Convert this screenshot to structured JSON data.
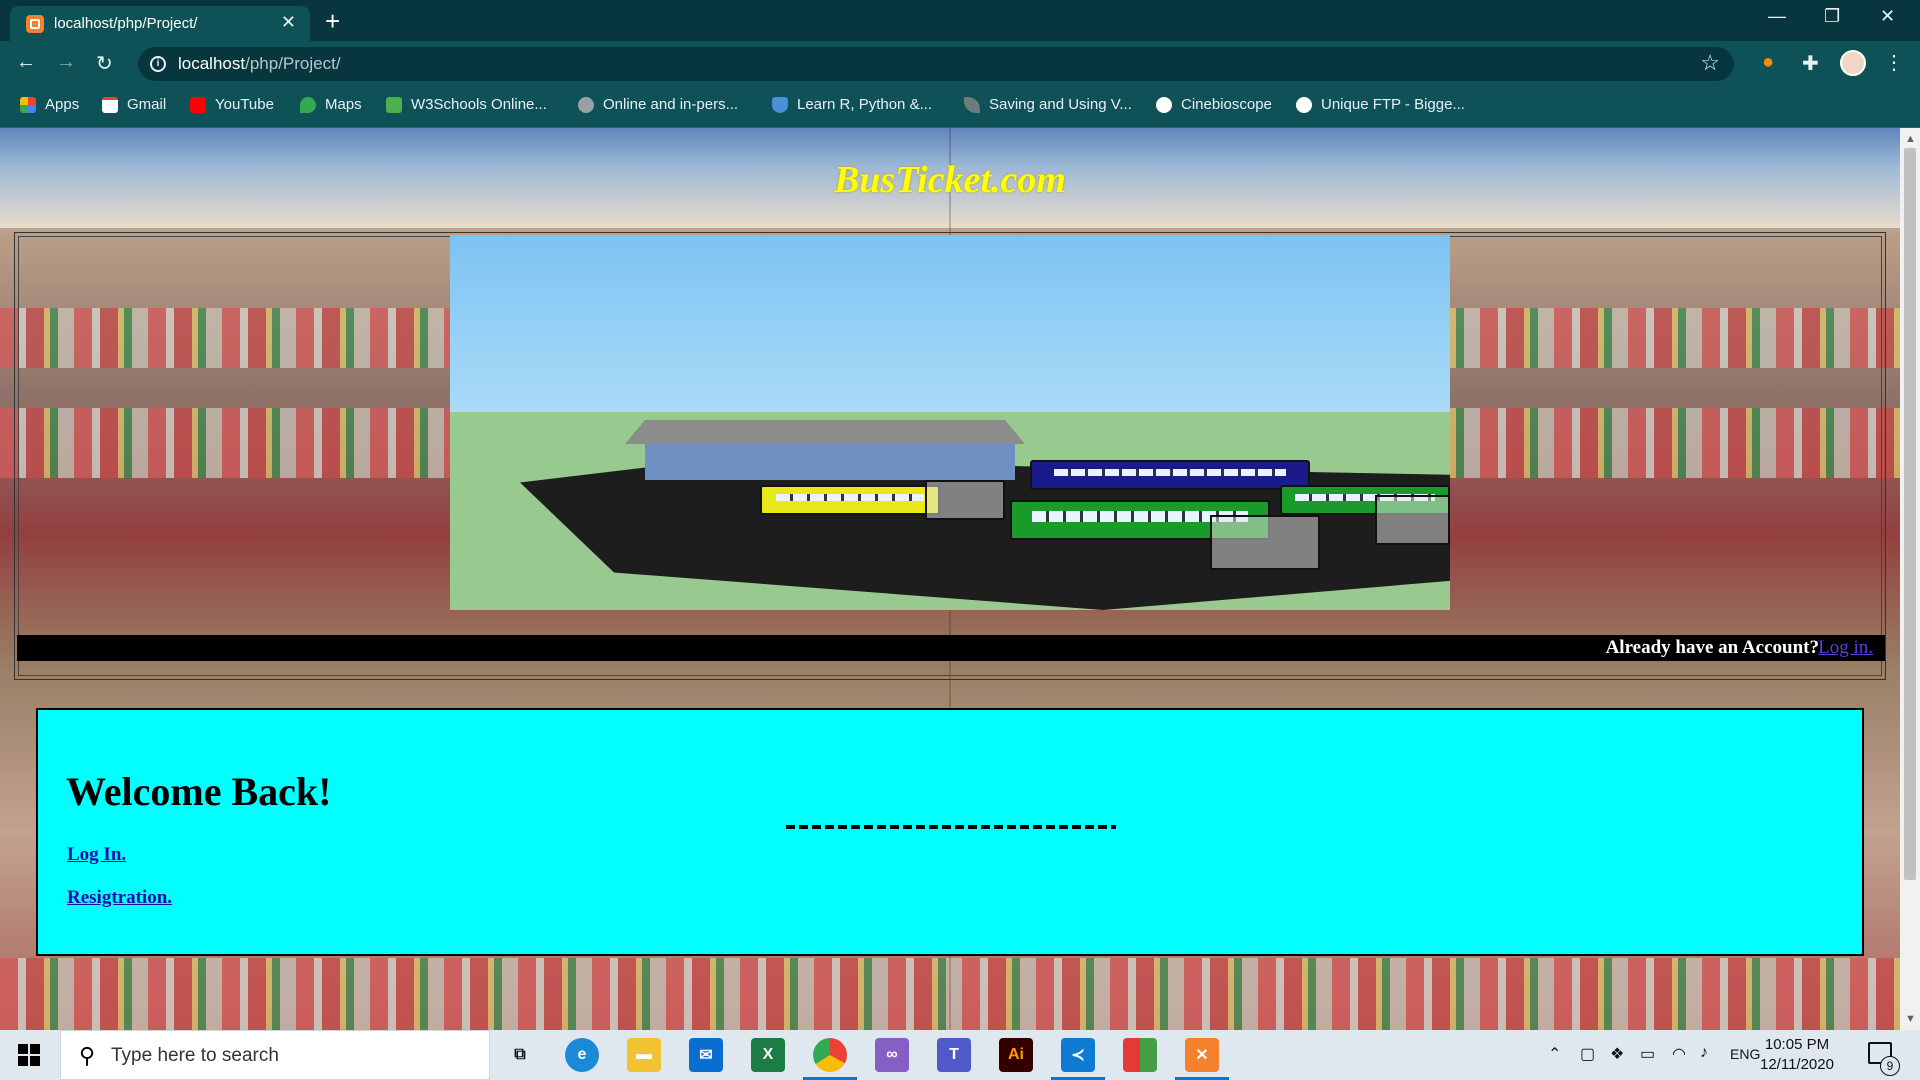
{
  "browser": {
    "tab_title": "localhost/php/Project/",
    "url_host": "localhost",
    "url_path": "/php/Project/",
    "bookmarks": [
      {
        "label": "Apps",
        "icon": "apps-grid-icon",
        "color": "#ea4335"
      },
      {
        "label": "Gmail",
        "icon": "gmail-icon",
        "color": "#ea4335"
      },
      {
        "label": "YouTube",
        "icon": "youtube-icon",
        "color": "#ff0000"
      },
      {
        "label": "Maps",
        "icon": "maps-icon",
        "color": "#34a853"
      },
      {
        "label": "W3Schools Online...",
        "icon": "w3schools-icon",
        "color": "#4caf50"
      },
      {
        "label": "Online and in-pers...",
        "icon": "site-icon",
        "color": "#9aa0a6"
      },
      {
        "label": "Learn R, Python &...",
        "icon": "shield-icon",
        "color": "#4a90d9"
      },
      {
        "label": "Saving and Using V...",
        "icon": "leaf-icon",
        "color": "#9aa0a6"
      },
      {
        "label": "Cinebioscope",
        "icon": "globe-icon",
        "color": "#ffffff"
      },
      {
        "label": "Unique FTP - Bigge...",
        "icon": "globe-icon",
        "color": "#ffffff"
      }
    ]
  },
  "page": {
    "site_title": "BusTicket.com",
    "login_prompt": "Already have an Account?",
    "login_link": "Log in.",
    "welcome_heading": "Welcome Back!",
    "login_menu": "Log In.",
    "registration_menu": "Resigtration."
  },
  "taskbar": {
    "search_placeholder": "Type here to search",
    "language": "ENG",
    "time": "10:05 PM",
    "date": "12/11/2020",
    "notification_count": "9"
  },
  "colors": {
    "site_title": "#ffff00",
    "welcome_panel": "#00ffff",
    "login_bar": "#000000",
    "chrome_frame": "#07363f"
  }
}
